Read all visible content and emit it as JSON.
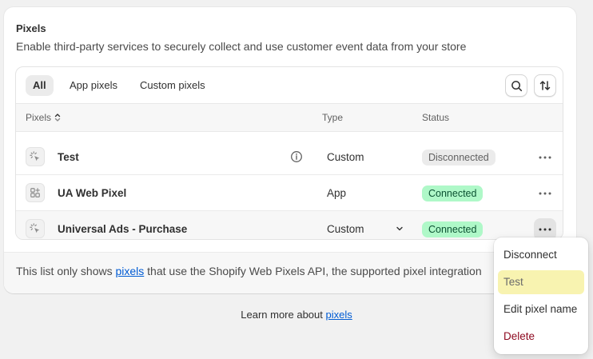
{
  "card": {
    "title": "Pixels",
    "description": "Enable third-party services to securely collect and use customer event data from your store"
  },
  "tabs": [
    {
      "label": "All",
      "active": true
    },
    {
      "label": "App pixels",
      "active": false
    },
    {
      "label": "Custom pixels",
      "active": false
    }
  ],
  "toolbar": {
    "search_icon": "search-icon",
    "sort_icon": "sort-icon"
  },
  "table": {
    "headers": {
      "pixels": "Pixels",
      "type": "Type",
      "status": "Status"
    },
    "rows": [
      {
        "name": "Test",
        "type": "Custom",
        "status": "Disconnected",
        "icon": "cursor-click-icon",
        "has_info": true
      },
      {
        "name": "UA Web Pixel",
        "type": "App",
        "status": "Connected",
        "icon": "apps-icon",
        "has_info": false
      },
      {
        "name": "Universal Ads - Purchase",
        "type": "Custom",
        "status": "Connected",
        "icon": "cursor-click-icon",
        "has_info": false
      }
    ]
  },
  "footer": {
    "before": "This list only shows ",
    "link": "pixels",
    "after": " that use the Shopify Web Pixels API, the supported pixel integration"
  },
  "learn_more": {
    "before": "Learn more about ",
    "link": "pixels"
  },
  "menu": {
    "items": [
      "Disconnect",
      "Test",
      "Edit pixel name",
      "Delete"
    ]
  },
  "colors": {
    "connected_bg": "#aff8c8",
    "connected_text": "#0c5132",
    "delete_text": "#8e0b21",
    "link": "#005bd3",
    "highlight": "#f8f3b0"
  }
}
